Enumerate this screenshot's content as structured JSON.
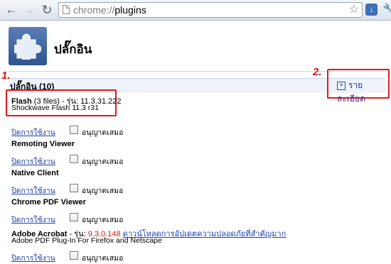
{
  "browser": {
    "url_scheme": "chrome://",
    "url_path": "plugins",
    "back_icon": "←",
    "forward_icon": "→",
    "reload_icon": "↻",
    "star_icon": "☆",
    "ext_icon": "↓",
    "menu_icon": "🔧"
  },
  "header": {
    "title": "ปลั๊กอิน"
  },
  "section": {
    "title": "ปลั๊กอิน (10)",
    "details_label": "รายละเอียด",
    "details_plus": "+"
  },
  "annotations": {
    "mark1": "1.",
    "mark2": "2."
  },
  "labels": {
    "disable": "ปิดการใช้งาน",
    "always_allow": "อนุญาตเสมอ"
  },
  "plugins": [
    {
      "name": "Flash",
      "files": "(3 files)",
      "version_prefix": " - รุ่น: 11.3.31.222",
      "line2": "Shockwave Flash 11.3 r31"
    },
    {
      "name": "Remoting Viewer"
    },
    {
      "name": "Native Client"
    },
    {
      "name": "Chrome PDF Viewer"
    },
    {
      "name": "Adobe Acrobat",
      "version_prefix": " - รุ่น: ",
      "version": "9.3.0.148",
      "update_link": "ดาวน์โหลดการอัปเดตความปลอดภัยที่สำคัญมาก",
      "line2": "Adobe PDF Plug-In For Firefox and Netscape"
    }
  ],
  "colors": {
    "accent_blue": "#1a3fb0",
    "annotation_red": "#e11a1a",
    "version_red": "#d11a1a"
  }
}
